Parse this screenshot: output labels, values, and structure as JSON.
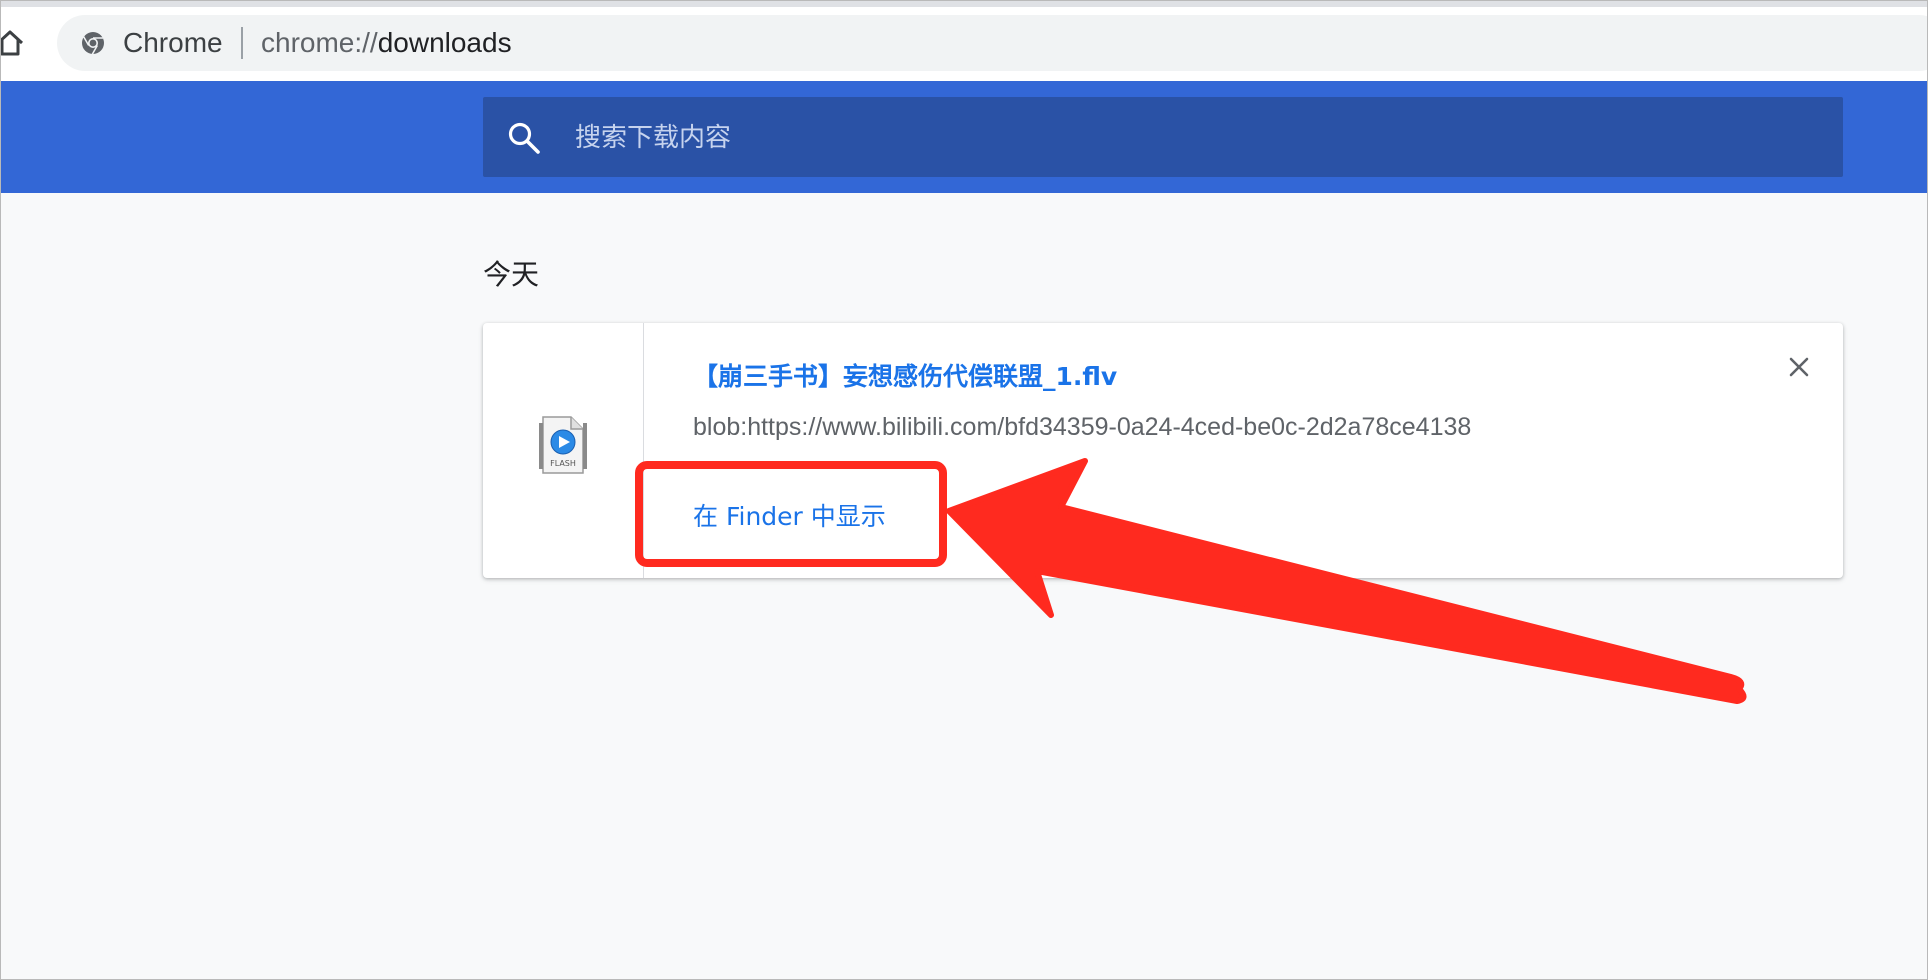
{
  "browser": {
    "site_label": "Chrome",
    "url_scheme": "chrome://",
    "url_path": "downloads"
  },
  "search": {
    "placeholder": "搜索下载内容"
  },
  "downloads": {
    "section_label": "今天",
    "items": [
      {
        "file_name": "【崩三手书】妄想感伤代偿联盟_1.flv",
        "source_url": "blob:https://www.bilibili.com/bfd34359-0a24-4ced-be0c-2d2a78ce4138",
        "action_label": "在 Finder 中显示",
        "file_type_label": "FLASH",
        "icon": "flash-video-file-icon"
      }
    ]
  },
  "icons": {
    "home": "home-icon",
    "chrome": "chrome-icon",
    "search": "search-icon",
    "close": "close-icon"
  },
  "colors": {
    "header_blue": "#3367d6",
    "search_box": "#2a52a6",
    "link_blue": "#1a73e8",
    "annotation_red": "#ff2a1f"
  }
}
